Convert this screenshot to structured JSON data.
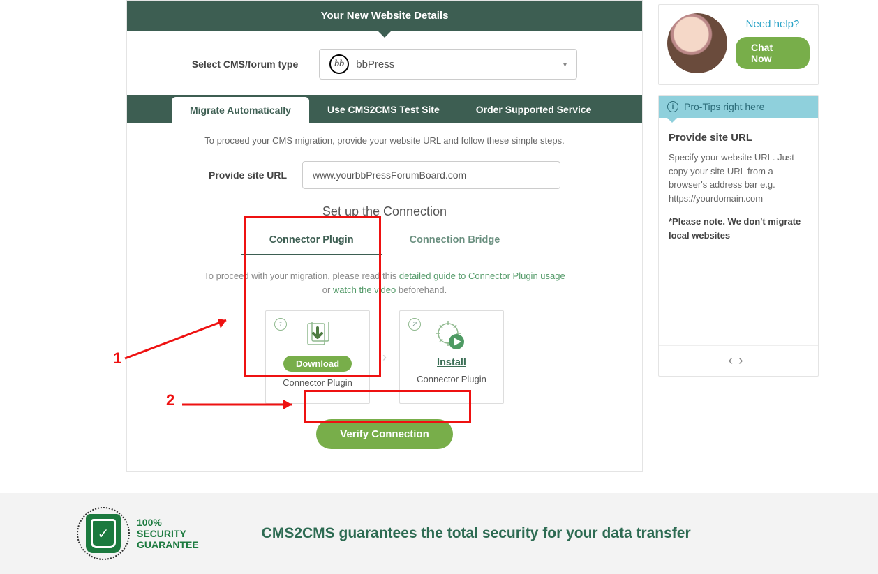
{
  "header": {
    "title": "Your New Website Details"
  },
  "cms": {
    "label": "Select CMS/forum type",
    "selected": "bbPress"
  },
  "tabs": [
    {
      "label": "Migrate Automatically",
      "active": true
    },
    {
      "label": "Use CMS2CMS Test Site",
      "active": false
    },
    {
      "label": "Order Supported Service",
      "active": false
    }
  ],
  "intro": "To proceed your CMS migration, provide your website URL and follow these simple steps.",
  "url": {
    "label": "Provide site URL",
    "value": "www.yourbbPressForumBoard.com"
  },
  "setup_heading": "Set up the Connection",
  "conn_tabs": [
    {
      "label": "Connector Plugin",
      "active": true
    },
    {
      "label": "Connection Bridge",
      "active": false
    }
  ],
  "proceed": {
    "pre": "To proceed with your migration, please read this ",
    "link1": "detailed guide to Connector Plugin usage",
    "mid": " or ",
    "link2": "watch the video",
    "post": " beforehand."
  },
  "cards": [
    {
      "num": "1",
      "action_label": "Download",
      "action_style": "button",
      "caption": "Connector Plugin"
    },
    {
      "num": "2",
      "action_label": "Install",
      "action_style": "link",
      "caption": "Connector Plugin"
    }
  ],
  "verify_label": "Verify Connection",
  "annotations": {
    "one": "1",
    "two": "2"
  },
  "help": {
    "need_help": "Need help?",
    "chat_now": "Chat Now"
  },
  "tips": {
    "header": "Pro-Tips right here",
    "title": "Provide site URL",
    "body": "Specify your website URL. Just copy your site URL from a browser's address bar e.g. https://yourdomain.com",
    "note": "*Please note. We don't migrate local websites"
  },
  "footer": {
    "badge_line1": "100%",
    "badge_line2": "SECURITY",
    "badge_line3": "GUARANTEE",
    "message": "CMS2CMS guarantees the total security for your data transfer"
  }
}
